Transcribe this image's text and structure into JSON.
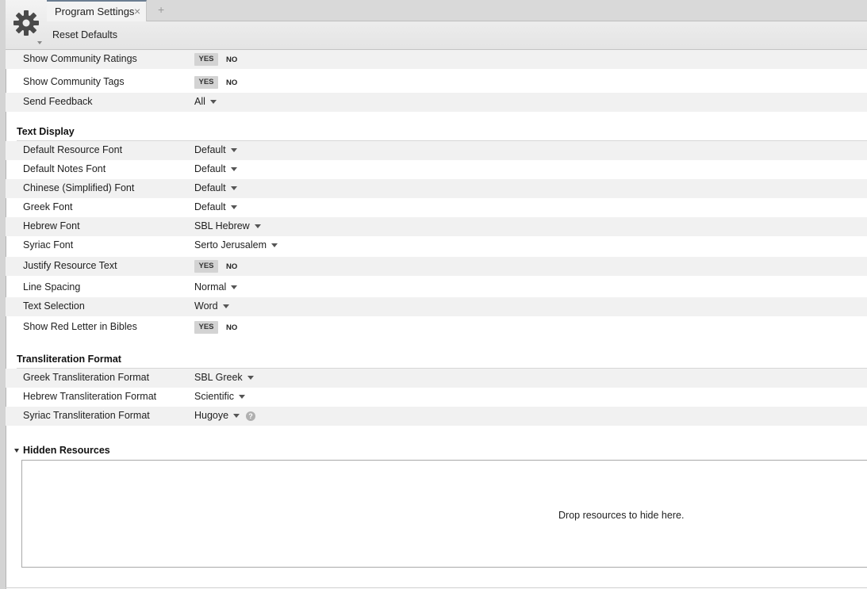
{
  "header": {
    "tab_label": "Program Settings",
    "tab_close_icon": "×",
    "tab_add_icon": "+",
    "reset_label": "Reset Defaults"
  },
  "toggle": {
    "yes": "YES",
    "no": "NO"
  },
  "general": {
    "show_community_ratings": {
      "label": "Show Community Ratings",
      "value": "YES"
    },
    "show_community_tags": {
      "label": "Show Community Tags",
      "value": "YES"
    },
    "send_feedback": {
      "label": "Send Feedback",
      "value": "All"
    }
  },
  "text_display": {
    "title": "Text Display",
    "default_resource_font": {
      "label": "Default Resource Font",
      "value": "Default"
    },
    "default_notes_font": {
      "label": "Default Notes Font",
      "value": "Default"
    },
    "chinese_font": {
      "label": "Chinese (Simplified) Font",
      "value": "Default"
    },
    "greek_font": {
      "label": "Greek Font",
      "value": "Default"
    },
    "hebrew_font": {
      "label": "Hebrew Font",
      "value": "SBL Hebrew"
    },
    "syriac_font": {
      "label": "Syriac Font",
      "value": "Serto Jerusalem"
    },
    "justify_resource_text": {
      "label": "Justify Resource Text",
      "value": "YES"
    },
    "line_spacing": {
      "label": "Line Spacing",
      "value": "Normal"
    },
    "text_selection": {
      "label": "Text Selection",
      "value": "Word"
    },
    "show_red_letter": {
      "label": "Show Red Letter in Bibles",
      "value": "YES"
    }
  },
  "transliteration": {
    "title": "Transliteration Format",
    "greek": {
      "label": "Greek Transliteration Format",
      "value": "SBL Greek"
    },
    "hebrew": {
      "label": "Hebrew Transliteration Format",
      "value": "Scientific"
    },
    "syriac": {
      "label": "Syriac Transliteration Format",
      "value": "Hugoye"
    },
    "help_icon": "?"
  },
  "hidden_resources": {
    "title": "Hidden Resources",
    "drop_text": "Drop resources to hide here."
  },
  "icons": {
    "gear": "gear-icon",
    "caret": "chevron-down-icon",
    "help": "question-circle-icon"
  }
}
